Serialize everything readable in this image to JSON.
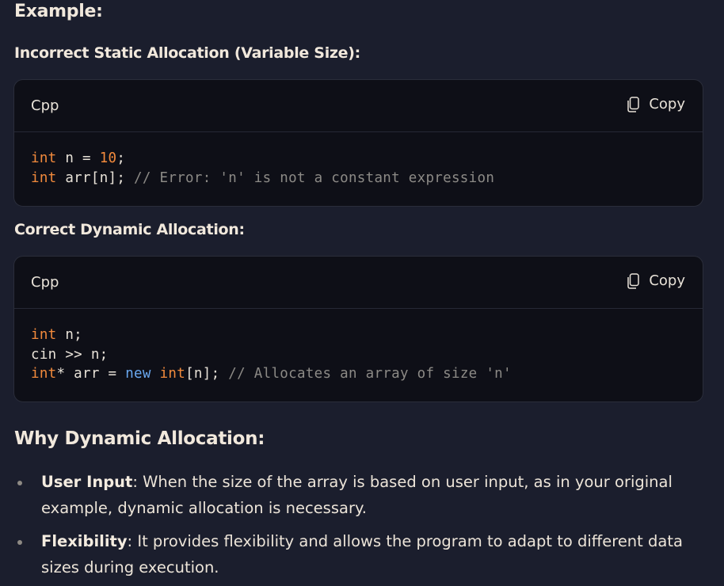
{
  "heading_example": "Example:",
  "section1": {
    "title": "Incorrect Static Allocation (Variable Size):",
    "lang": "Cpp",
    "copy_label": "Copy",
    "code_line1": [
      "int",
      " n = ",
      "10",
      ";"
    ],
    "code_line2": [
      "int",
      " arr[n]; ",
      "// Error: 'n' is not a constant expression"
    ]
  },
  "section2": {
    "title": "Correct Dynamic Allocation:",
    "lang": "Cpp",
    "copy_label": "Copy",
    "code_line1": [
      "int",
      " n;"
    ],
    "code_line2": [
      "cin >> n;"
    ],
    "code_line3": [
      "int",
      "* arr = ",
      "new",
      " ",
      "int",
      "[n]; ",
      "// Allocates an array of size 'n'"
    ]
  },
  "why": {
    "title": "Why Dynamic Allocation:",
    "bullets": [
      {
        "term": "User Input",
        "text": ": When the size of the array is based on user input, as in your original example, dynamic allocation is necessary."
      },
      {
        "term": "Flexibility",
        "text": ": It provides flexibility and allows the program to adapt to different data sizes during execution."
      }
    ]
  },
  "icons": {
    "copy": "copy-icon"
  },
  "colors": {
    "background": "#1b1e2d",
    "code_background": "#0e0f17",
    "keyword": "#f28a3c",
    "new_keyword": "#6aa8f0",
    "comment": "#8c8a86"
  }
}
